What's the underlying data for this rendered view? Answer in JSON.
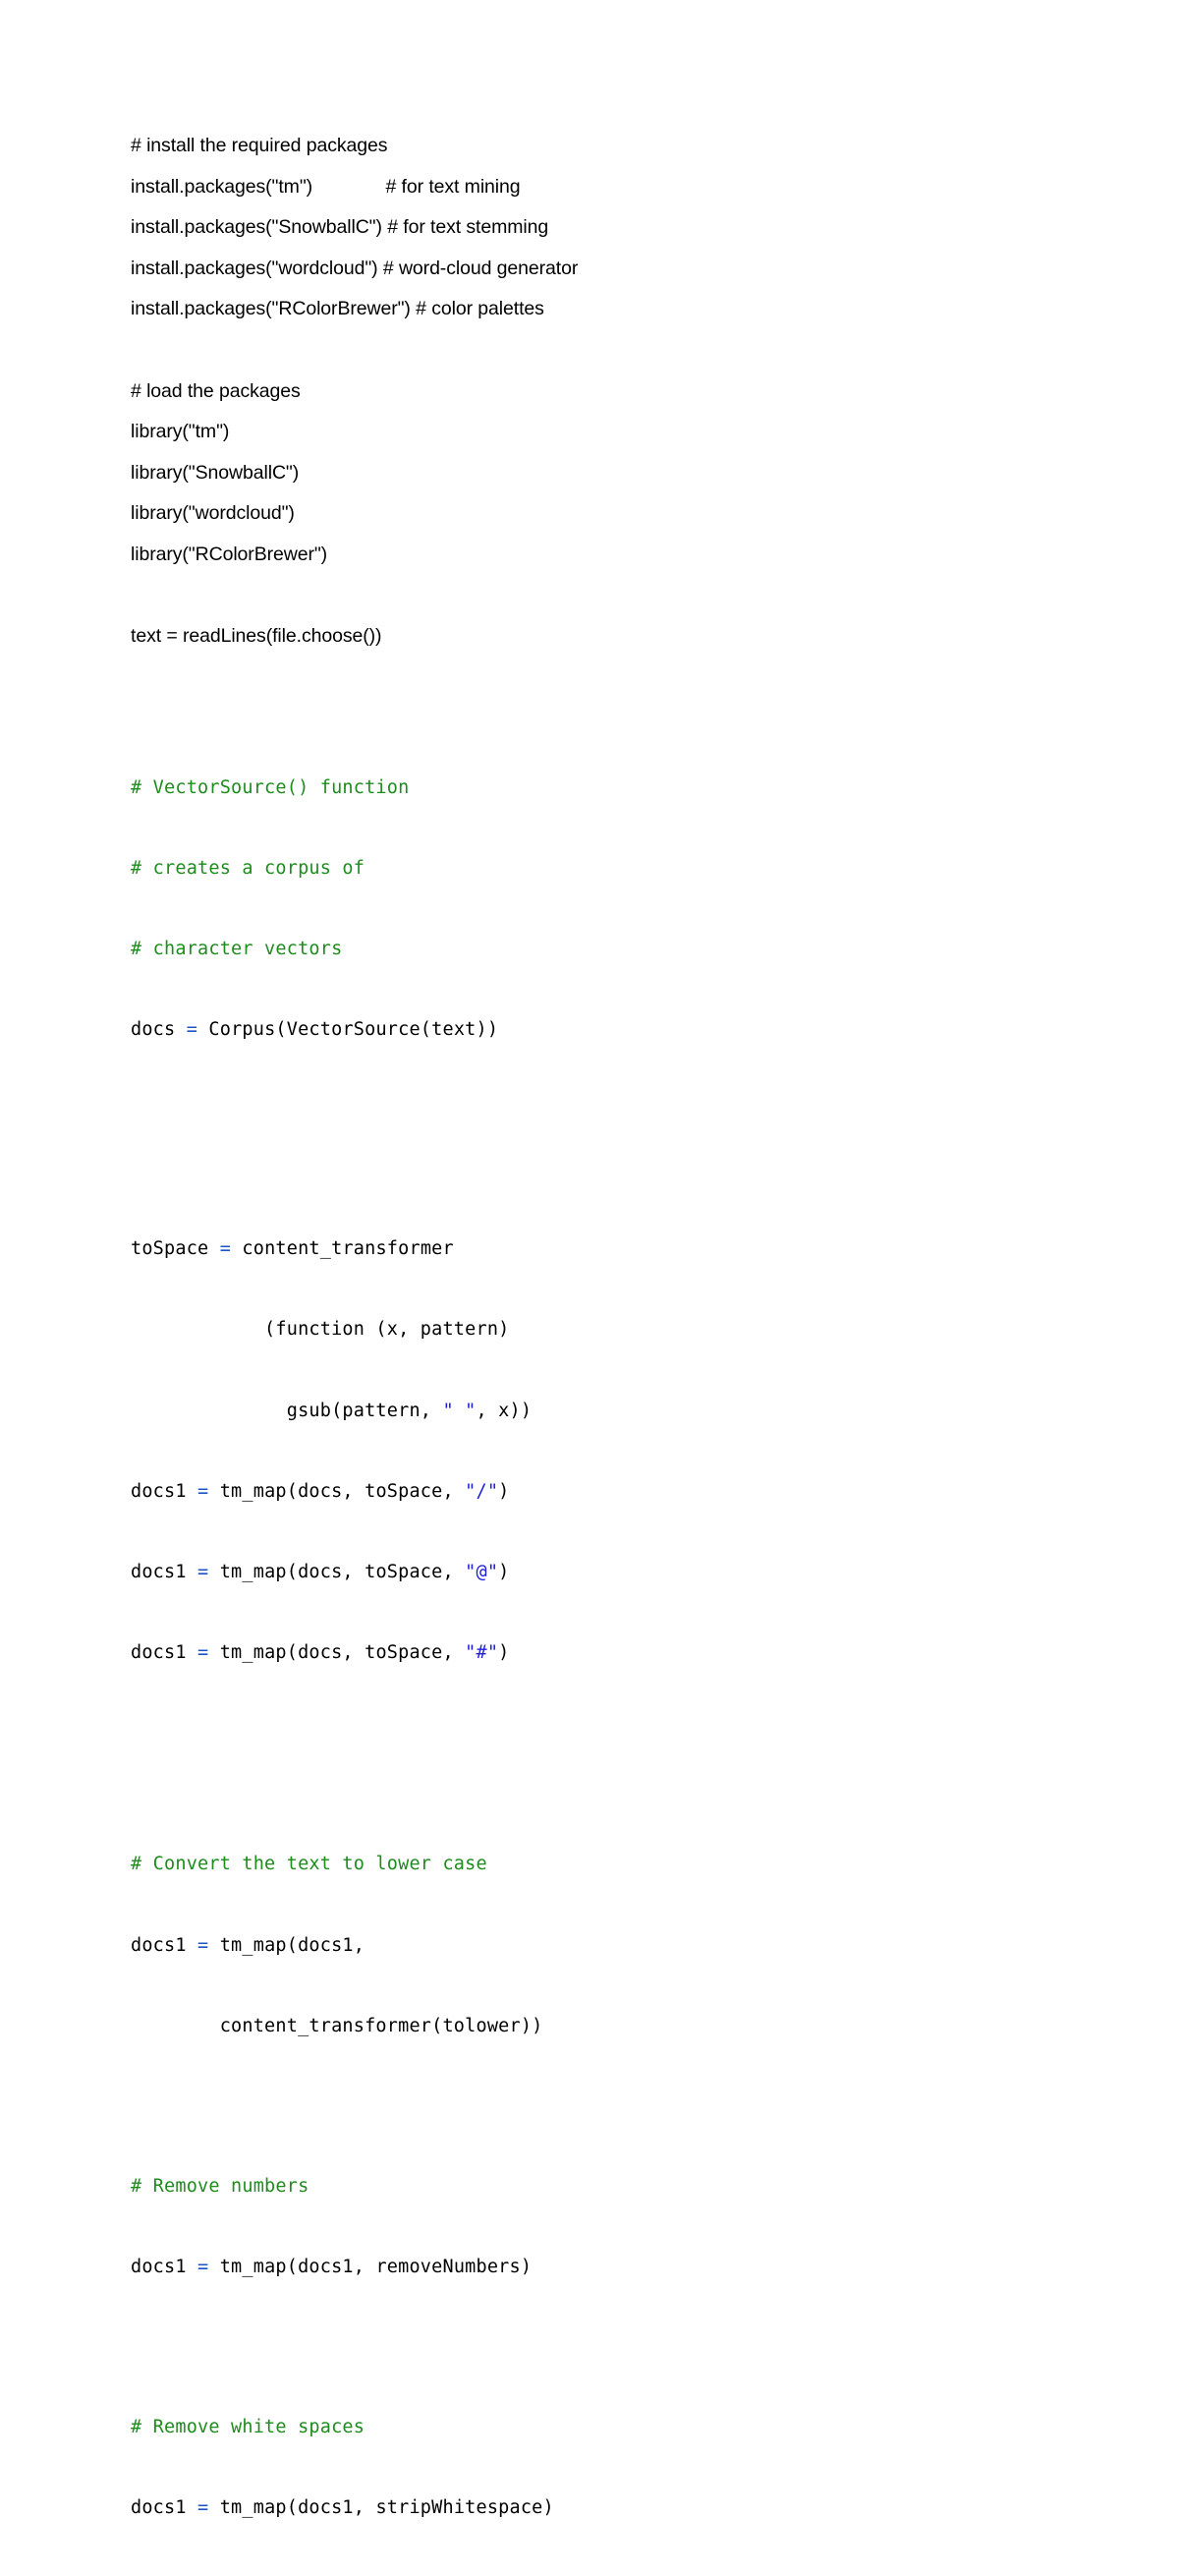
{
  "document": {
    "type": "r-script-listing",
    "page_background": "#ffffff",
    "colors": {
      "text": "#000000",
      "comment_green": "#1e8c1e",
      "operator_blue": "#1b54c7",
      "string_blue": "#1b1bdd"
    }
  },
  "prose_section": {
    "lines": [
      {
        "id": "install-comment",
        "text": "# install the required packages"
      },
      {
        "id": "install-tm",
        "text": "install.packages(\"tm\")              # for text mining"
      },
      {
        "id": "install-snowballc",
        "text": "install.packages(\"SnowballC\") # for text stemming"
      },
      {
        "id": "install-wordcloud",
        "text": "install.packages(\"wordcloud\") # word-cloud generator"
      },
      {
        "id": "install-rcolorbrewer",
        "text": "install.packages(\"RColorBrewer\") # color palettes"
      },
      {
        "id": "load-comment",
        "text": "# load the packages"
      },
      {
        "id": "library-tm",
        "text": "library(\"tm\")"
      },
      {
        "id": "library-snowballc",
        "text": "library(\"SnowballC\")"
      },
      {
        "id": "library-wordcloud",
        "text": "library(\"wordcloud\")"
      },
      {
        "id": "library-rcolorbrewer",
        "text": "library(\"RColorBrewer\")"
      },
      {
        "id": "read-lines",
        "text": "text = readLines(file.choose())"
      }
    ]
  },
  "mono_section": {
    "vectorsource_block": {
      "comment_1": "# VectorSource() function",
      "comment_2": "# creates a corpus of",
      "comment_3": "# character vectors",
      "code_var": "docs ",
      "code_op": "= ",
      "code_rest": "Corpus(VectorSource(text))"
    },
    "tospace_block": {
      "line1_var": "toSpace ",
      "line1_op": "= ",
      "line1_rest": "content_transformer",
      "line2": "            (function (x, pattern)",
      "line3_pre": "              gsub(pattern, ",
      "line3_str": "\" \"",
      "line3_post": ", x))",
      "map_slash_var": "docs1 ",
      "map_slash_op": "= ",
      "map_slash_pre": "tm_map(docs, toSpace, ",
      "map_slash_str": "\"/\"",
      "map_slash_post": ")",
      "map_at_var": "docs1 ",
      "map_at_op": "= ",
      "map_at_pre": "tm_map(docs, toSpace, ",
      "map_at_str": "\"@\"",
      "map_at_post": ")",
      "map_hash_var": "docs1 ",
      "map_hash_op": "= ",
      "map_hash_pre": "tm_map(docs, toSpace, ",
      "map_hash_str": "\"#\"",
      "map_hash_post": ")"
    },
    "lowercase_block": {
      "comment": "# Convert the text to lower case",
      "code_var": "docs1 ",
      "code_op": "= ",
      "code_rest": "tm_map(docs1,",
      "code_cont": "        content_transformer(tolower))"
    },
    "removenumbers_block": {
      "comment": "# Remove numbers",
      "code_var": "docs1 ",
      "code_op": "= ",
      "code_rest": "tm_map(docs1, removeNumbers)"
    },
    "whitespace_block": {
      "comment": "# Remove white spaces",
      "code_var": "docs1 ",
      "code_op": "= ",
      "code_rest": "tm_map(docs1, stripWhitespace)"
    }
  }
}
